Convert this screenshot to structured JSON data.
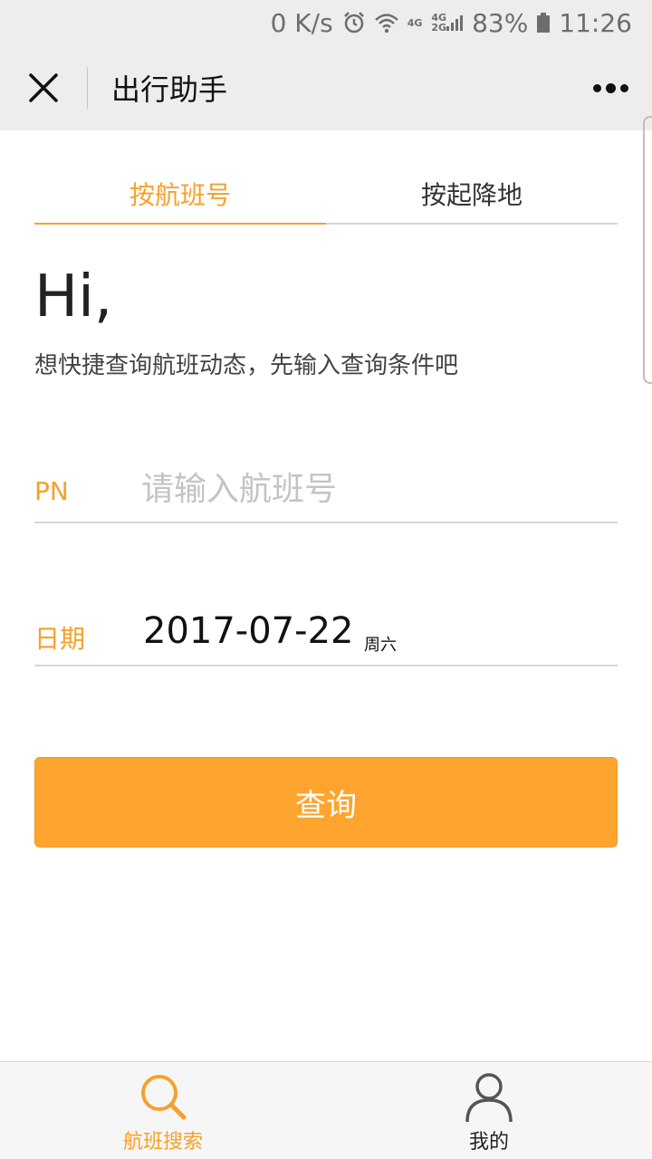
{
  "status_bar": {
    "net_speed": "0 K/s",
    "network_label_1": "4G",
    "network_label_2a": "4G",
    "network_label_2b": "2G",
    "battery": "83%",
    "time": "11:26"
  },
  "titlebar": {
    "title": "出行助手"
  },
  "tabs": [
    {
      "label": "按航班号",
      "active": true
    },
    {
      "label": "按起降地",
      "active": false
    }
  ],
  "greeting": "Hi,",
  "subtitle": "想快捷查询航班动态，先输入查询条件吧",
  "form": {
    "pn_label": "PN",
    "pn_placeholder": "请输入航班号",
    "pn_value": "",
    "date_label": "日期",
    "date_value": "2017-07-22",
    "weekday": "周六"
  },
  "query_button": "查询",
  "bottom_nav": [
    {
      "label": "航班搜索",
      "icon": "search-icon",
      "active": true
    },
    {
      "label": "我的",
      "icon": "user-icon",
      "active": false
    }
  ],
  "colors": {
    "accent": "#f5a12c",
    "button_bg": "#ffa42f",
    "header_bg": "#ededed"
  }
}
